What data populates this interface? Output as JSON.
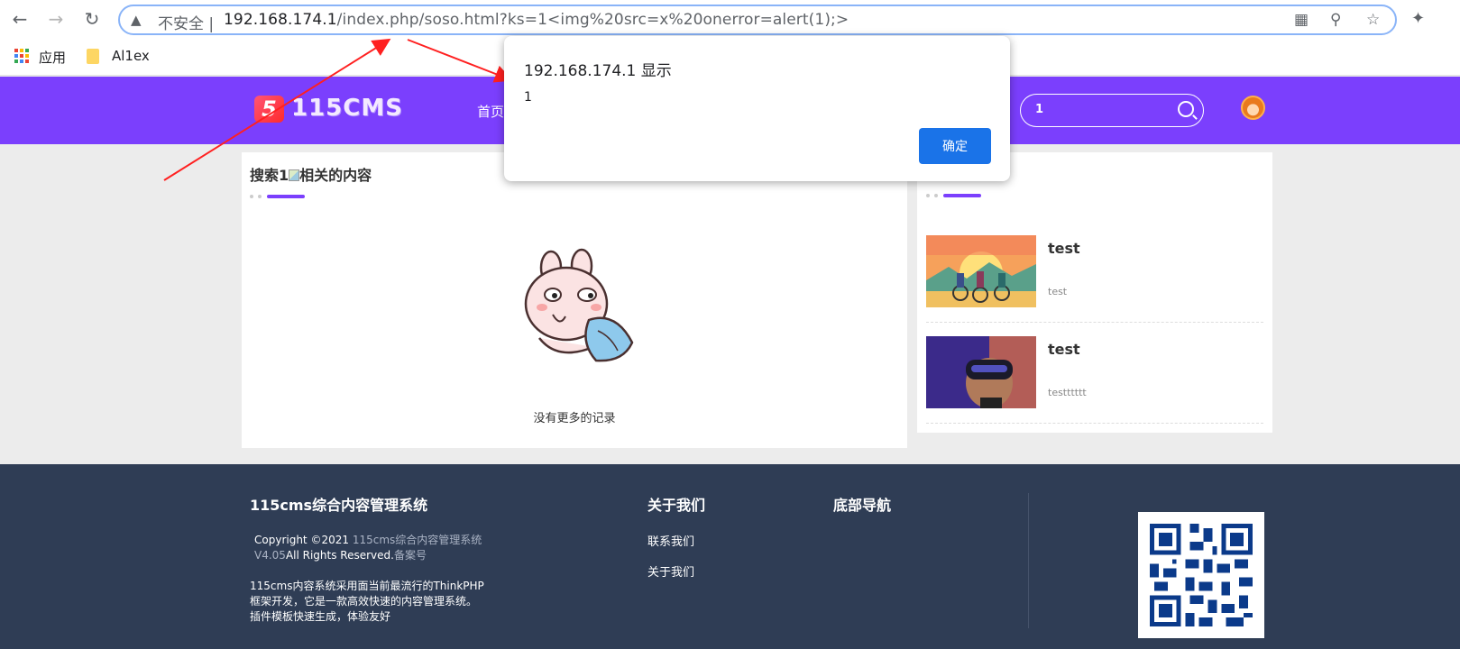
{
  "browser": {
    "security_label": "不安全",
    "url_host": "192.168.174.1",
    "url_path": "/index.php/soso.html?ks=1<img%20src=x%20onerror=alert(1);>"
  },
  "bookmarks": {
    "apps_label": "应用",
    "folder_label": "Al1ex"
  },
  "site": {
    "logo_badge": "5",
    "logo_text": "115CMS",
    "nav_home": "首页",
    "search_value": "1"
  },
  "main": {
    "title_prefix": "搜索1",
    "title_suffix": "相关的内容",
    "empty_text": "没有更多的记录"
  },
  "sidebar": {
    "items": [
      {
        "title": "test",
        "desc": "test"
      },
      {
        "title": "test",
        "desc": "testttttt"
      }
    ]
  },
  "footer": {
    "brand_title": "115cms综合内容管理系统",
    "copyright_prefix": "Copyright ©2021",
    "copyright_link": "115cms综合内容管理系统",
    "version": "V4.05",
    "rights": "All Rights Reserved.",
    "icp": "备案号",
    "desc_line1": "115cms内容系统采用面当前最流行的ThinkPHP",
    "desc_line2": "框架开发，它是一款高效快速的内容管理系统。",
    "desc_line3": "插件模板快速生成，体验友好",
    "about_title": "关于我们",
    "about_links": [
      "联系我们",
      "关于我们"
    ],
    "nav_title": "底部导航"
  },
  "dialog": {
    "title": "192.168.174.1 显示",
    "message": "1",
    "ok_label": "确定"
  },
  "colors": {
    "header_bg": "#7b3ffd",
    "footer_bg": "#2f3d55",
    "button_blue": "#1a73e8",
    "arrow_red": "#ff2020"
  }
}
